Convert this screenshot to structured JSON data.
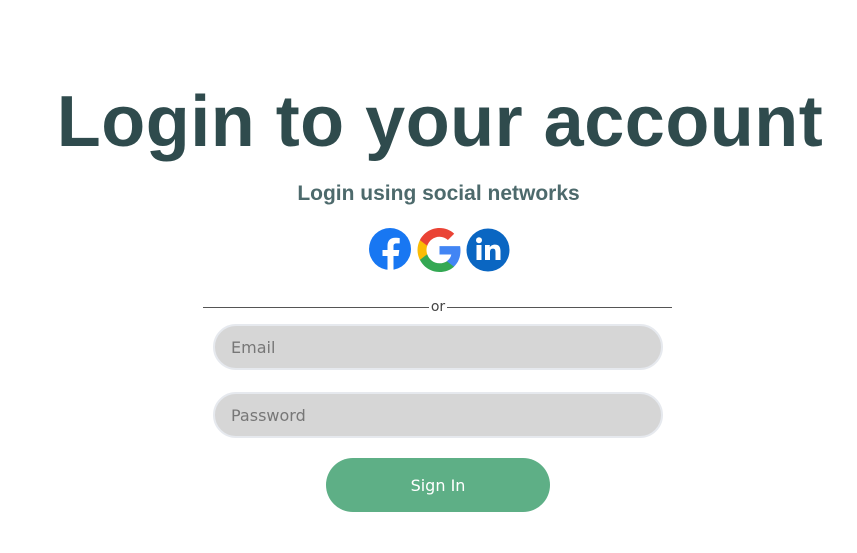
{
  "header": {
    "title": "Login to your account",
    "subtitle": "Login using social networks"
  },
  "social": {
    "items": [
      {
        "icon": "facebook-icon",
        "color": "#1877f2"
      },
      {
        "icon": "google-icon",
        "colors": [
          "#ea4335",
          "#fbbc05",
          "#34a853",
          "#4285f4"
        ]
      },
      {
        "icon": "linkedin-icon",
        "color": "#0a66c2"
      }
    ]
  },
  "divider": {
    "text": "or"
  },
  "form": {
    "email_placeholder": "Email",
    "password_placeholder": "Password",
    "submit_label": "Sign In"
  },
  "colors": {
    "title": "#2f4b4d",
    "subtitle": "#4d6a6c",
    "input_bg": "#d6d6d6",
    "button_bg": "#5eaf86",
    "button_text": "#ffffff"
  }
}
